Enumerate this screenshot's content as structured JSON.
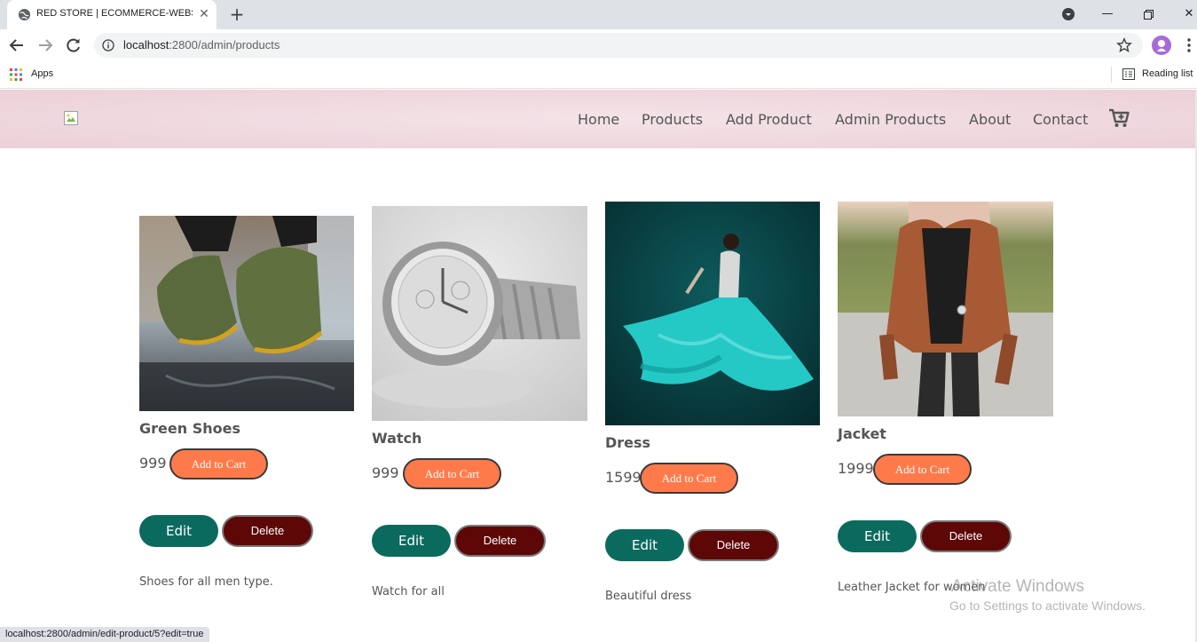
{
  "browser": {
    "tab_title": "RED STORE | ECOMMERCE-WEBS",
    "url_host": "localhost",
    "url_path": ":2800/admin/products",
    "bookmarks": {
      "apps_label": "Apps",
      "reading_list_label": "Reading list"
    },
    "status_url": "localhost:2800/admin/edit-product/5?edit=true"
  },
  "nav": {
    "items": [
      "Home",
      "Products",
      "Add Product",
      "Admin Products",
      "About",
      "Contact"
    ]
  },
  "products": [
    {
      "title": "Green Shoes",
      "price": "999",
      "add_to_cart": "Add to Cart",
      "edit": "Edit",
      "delete": "Delete",
      "description": "Shoes for all men type."
    },
    {
      "title": "Watch",
      "price": "999",
      "add_to_cart": "Add to Cart",
      "edit": "Edit",
      "delete": "Delete",
      "description": "Watch for all"
    },
    {
      "title": "Dress",
      "price": "1599",
      "add_to_cart": "Add to Cart",
      "edit": "Edit",
      "delete": "Delete",
      "description": "Beautiful dress"
    },
    {
      "title": "Jacket",
      "price": "1999",
      "add_to_cart": "Add to Cart",
      "edit": "Edit",
      "delete": "Delete",
      "description": "Leather Jacket for women"
    }
  ],
  "os_overlay": {
    "line1": "Activate Windows",
    "line2": "Go to Settings to activate Windows."
  },
  "colors": {
    "header_bg": "#ecd0d8",
    "add_to_cart": "#ff7a4a",
    "edit": "#0b6a5e",
    "delete": "#5e0707"
  }
}
